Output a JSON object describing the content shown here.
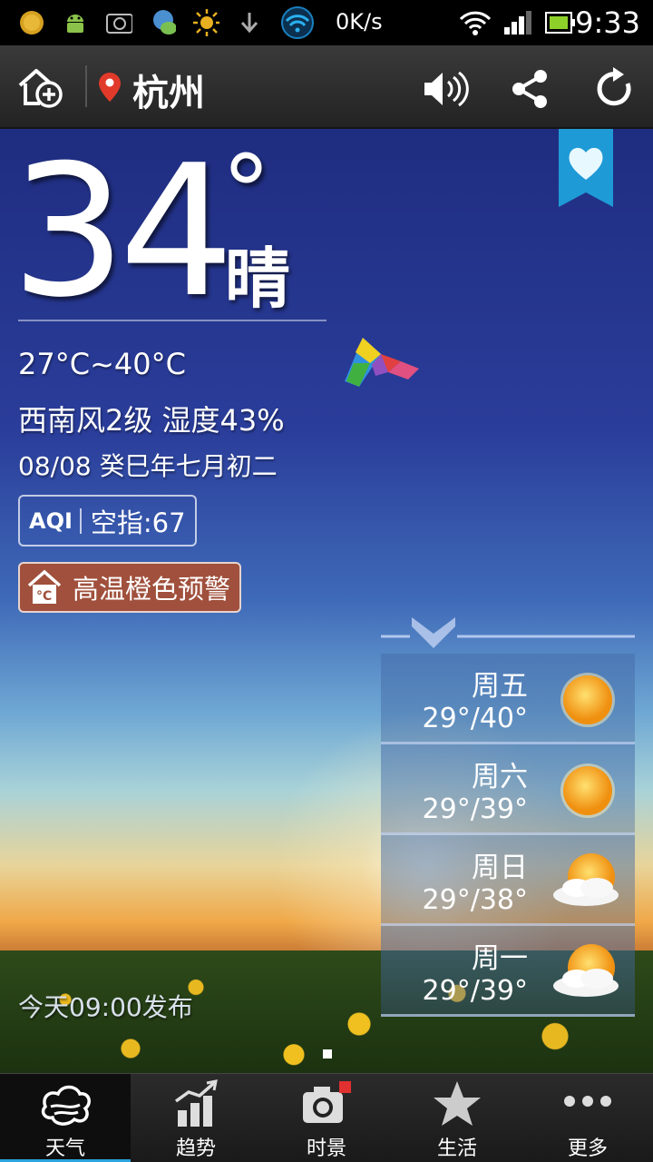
{
  "status_bar": {
    "net_speed": "0K/s",
    "time": "9:33",
    "icons": [
      "sun-app-icon",
      "android-icon",
      "screenshot-icon",
      "chat-icon",
      "brightness-icon",
      "download-icon",
      "wifi-app-icon",
      "wifi-signal-icon",
      "cell-signal-icon",
      "battery-icon"
    ]
  },
  "toolbar": {
    "city": "杭州",
    "icons": [
      "add-city-icon",
      "location-pin-icon",
      "sound-icon",
      "share-icon",
      "refresh-icon"
    ]
  },
  "current": {
    "temperature": "34",
    "degree": "°",
    "condition": "晴",
    "temp_range": "27°C~40°C",
    "wind_humidity": "西南风2级 湿度43%",
    "date_lunar": "08/08 癸巳年七月初二",
    "aqi_label": "AQI",
    "aqi_text": "空指:67",
    "alert_text": "高温橙色预警",
    "publish_time": "今天09:00发布"
  },
  "forecast": [
    {
      "day": "周五",
      "temp": "29°/40°",
      "icon": "sunny-icon"
    },
    {
      "day": "周六",
      "temp": "29°/39°",
      "icon": "sunny-icon"
    },
    {
      "day": "周日",
      "temp": "29°/38°",
      "icon": "partly-cloudy-icon"
    },
    {
      "day": "周一",
      "temp": "29°/39°",
      "icon": "partly-cloudy-icon"
    }
  ],
  "bottom_nav": [
    {
      "label": "天气",
      "icon": "weather-cloud-icon",
      "active": true
    },
    {
      "label": "趋势",
      "icon": "trend-chart-icon",
      "active": false
    },
    {
      "label": "时景",
      "icon": "camera-icon",
      "active": false
    },
    {
      "label": "生活",
      "icon": "star-icon",
      "active": false
    },
    {
      "label": "更多",
      "icon": "more-dots-icon",
      "active": false
    }
  ],
  "colors": {
    "alert_bg": "#a0503c",
    "nav_active_underline": "#2aa4e0",
    "bookmark": "#1e9ad6",
    "location_pin": "#e23a2a"
  }
}
